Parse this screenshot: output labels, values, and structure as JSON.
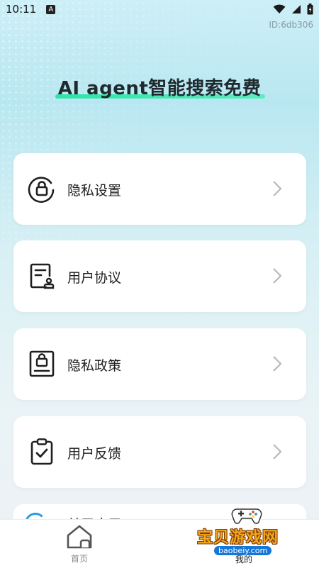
{
  "status_bar": {
    "time": "10:11",
    "notification_letter": "A"
  },
  "id_label": "ID:6db306",
  "headline": "AI agent智能搜索免费",
  "menu": [
    {
      "label": "隐私设置",
      "icon": "lock-circle-icon"
    },
    {
      "label": "用户协议",
      "icon": "document-user-icon"
    },
    {
      "label": "隐私政策",
      "icon": "document-lock-icon"
    },
    {
      "label": "用户反馈",
      "icon": "clipboard-check-icon"
    },
    {
      "label": "关于应用",
      "icon": "info-circle-icon"
    }
  ],
  "tabs": [
    {
      "label": "首页",
      "icon": "home-icon"
    },
    {
      "label": "我的",
      "icon": "user-icon"
    }
  ],
  "watermark": {
    "text": "宝贝游戏网",
    "url": "baobeiy.com"
  },
  "colors": {
    "accent_green": "#2ee6a6",
    "icon_dark": "#1f1f1f",
    "chevron": "#b5b5b5",
    "watermark_orange": "#f4a51c"
  }
}
